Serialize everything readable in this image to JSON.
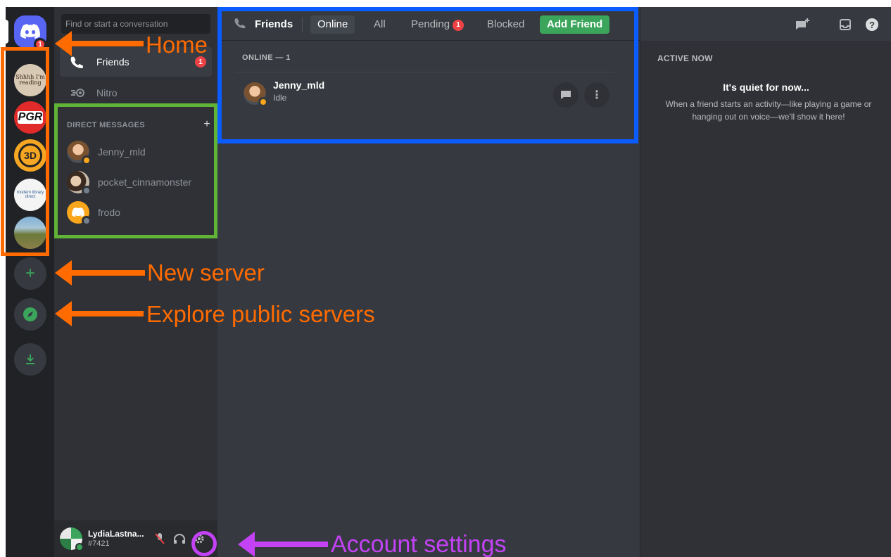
{
  "rail": {
    "home_badge": "1",
    "servers": [
      {
        "name": "shhh",
        "text": "Shhhh I'm reading"
      },
      {
        "name": "pgr",
        "text": "PGR"
      },
      {
        "name": "3d",
        "text": "3D"
      },
      {
        "name": "modern-library",
        "text": "modern library direct"
      },
      {
        "name": "landscape",
        "text": ""
      }
    ]
  },
  "sidebar": {
    "search_placeholder": "Find or start a conversation",
    "friends_label": "Friends",
    "friends_badge": "1",
    "nitro_label": "Nitro",
    "dm_header": "DIRECT MESSAGES",
    "dm_plus": "+",
    "dms": [
      {
        "name": "Jenny_mld",
        "status": "idle"
      },
      {
        "name": "pocket_cinnamonster",
        "status": "offline"
      },
      {
        "name": "frodo",
        "status": "offline"
      }
    ]
  },
  "user": {
    "name": "LydiaLastna...",
    "tag": "#7421"
  },
  "topbar": {
    "title": "Friends",
    "tabs": {
      "online": "Online",
      "all": "All",
      "pending": "Pending",
      "pending_badge": "1",
      "blocked": "Blocked",
      "add_friend": "Add Friend"
    }
  },
  "friends_list": {
    "header": "ONLINE — 1",
    "items": [
      {
        "name": "Jenny_mld",
        "status": "Idle"
      }
    ]
  },
  "active_now": {
    "title": "ACTIVE NOW",
    "empty_title": "It's quiet for now...",
    "empty_desc": "When a friend starts an activity—like playing a game or hanging out on voice—we'll show it here!"
  },
  "annotations": {
    "home": "Home",
    "new_server": "New server",
    "explore": "Explore public servers",
    "account": "Account settings"
  },
  "colors": {
    "blurple": "#5865f2",
    "green": "#3ba55c",
    "red": "#ed4245",
    "annotation_orange": "#ff6b00",
    "annotation_green": "#5fb336",
    "annotation_blue": "#0a5cff",
    "annotation_purple": "#c342f5"
  }
}
